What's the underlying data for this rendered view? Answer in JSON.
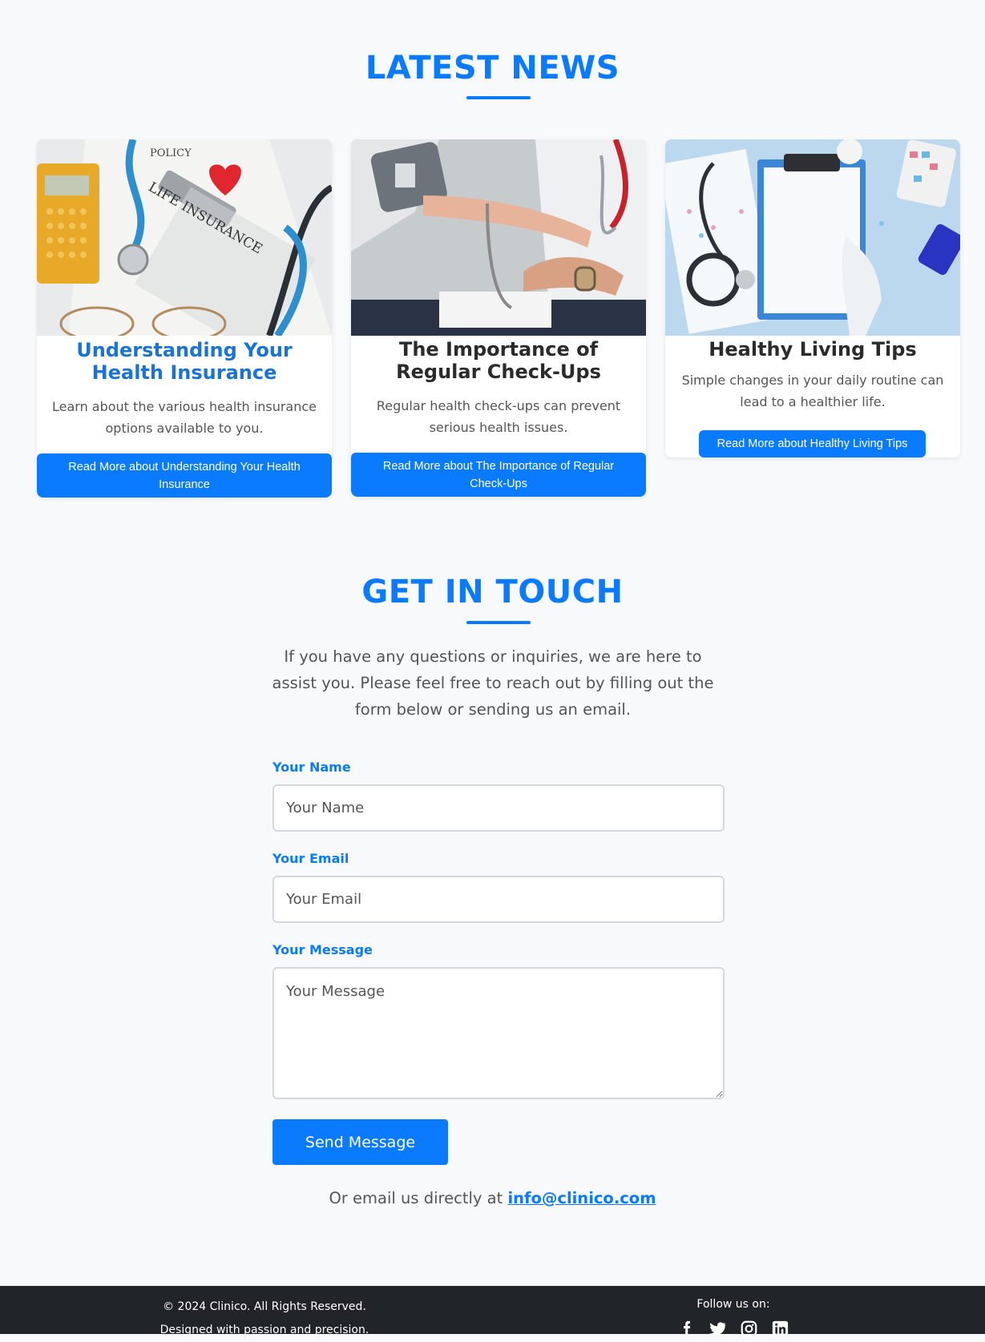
{
  "news": {
    "title": "LATEST NEWS",
    "articles": [
      {
        "title": "Understanding Your Health Insurance",
        "description": "Learn about the various health insurance options available to you.",
        "button": "Read More about Understanding Your Health Insurance",
        "image_text_top": "POLICY",
        "image_text_main": "LIFE INSURANCE"
      },
      {
        "title": "The Importance of Regular Check-Ups",
        "description": "Regular health check-ups can prevent serious health issues.",
        "button": "Read More about The Importance of Regular Check-Ups"
      },
      {
        "title": "Healthy Living Tips",
        "description": "Simple changes in your daily routine can lead to a healthier life.",
        "button": "Read More about Healthy Living Tips"
      }
    ]
  },
  "contact": {
    "title": "GET IN TOUCH",
    "intro": "If you have any questions or inquiries, we are here to assist you. Please feel free to reach out by filling out the form below or sending us an email.",
    "name_label": "Your Name",
    "name_placeholder": "Your Name",
    "email_label": "Your Email",
    "email_placeholder": "Your Email",
    "message_label": "Your Message",
    "message_placeholder": "Your Message",
    "submit": "Send Message",
    "email_prefix": "Or email us directly at",
    "email_address": "info@clinico.com"
  },
  "footer": {
    "copyright": "© 2024 Clinico. All Rights Reserved.",
    "tagline": "Designed with passion and precision.",
    "follow": "Follow us on:",
    "socials": [
      "facebook-icon",
      "twitter-icon",
      "instagram-icon",
      "linkedin-icon"
    ]
  },
  "colors": {
    "accent": "#0a7bff",
    "background": "#f7f9fb",
    "footer": "#212529"
  }
}
